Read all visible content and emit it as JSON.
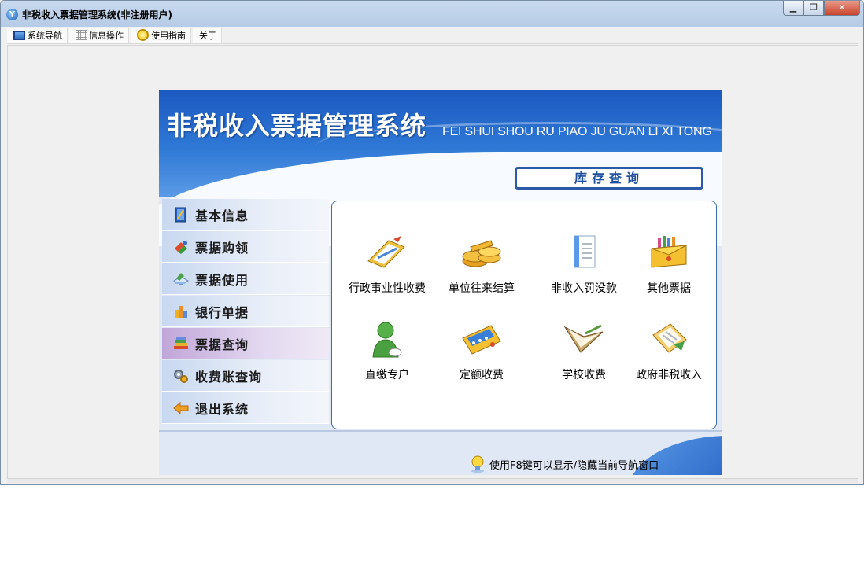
{
  "window": {
    "title": "非税收入票据管理系统(非注册用户)",
    "app_icon": "app-logo-icon",
    "controls": {
      "minimize": "▁",
      "restore": "❐",
      "close": "✕"
    }
  },
  "menubar": {
    "items": [
      {
        "label": "系统导航",
        "icon": "navigation-icon"
      },
      {
        "label": "信息操作",
        "icon": "grid-icon"
      },
      {
        "label": "使用指南",
        "icon": "help-icon"
      },
      {
        "label": "关于",
        "icon": ""
      }
    ]
  },
  "banner": {
    "title": "非税收入票据管理系统",
    "subtitle": "FEI SHUI SHOU RU PIAO JU GUAN LI XI TONG"
  },
  "section": {
    "title": "库存查询"
  },
  "sidebar": {
    "items": [
      {
        "label": "基本信息",
        "icon": "book-icon",
        "active": false
      },
      {
        "label": "票据购领",
        "icon": "pencil-icon",
        "active": false
      },
      {
        "label": "票据使用",
        "icon": "papers-icon",
        "active": false
      },
      {
        "label": "银行单据",
        "icon": "bank-icon",
        "active": false
      },
      {
        "label": "票据查询",
        "icon": "books-icon",
        "active": true
      },
      {
        "label": "收费账查询",
        "icon": "gears-icon",
        "active": false
      },
      {
        "label": "退出系统",
        "icon": "exit-arrow-icon",
        "active": false
      }
    ]
  },
  "grid": {
    "items": [
      {
        "label": "行政事业性收费",
        "icon": "notepad-icon"
      },
      {
        "label": "单位往来结算",
        "icon": "coins-icon"
      },
      {
        "label": "非收入罚没款",
        "icon": "document-icon"
      },
      {
        "label": "其他票据",
        "icon": "folder-box-icon"
      },
      {
        "label": "直缴专户",
        "icon": "user-icon"
      },
      {
        "label": "定额收费",
        "icon": "calculator-icon"
      },
      {
        "label": "学校收费",
        "icon": "open-book-icon"
      },
      {
        "label": "政府非税收入",
        "icon": "ledger-icon"
      }
    ]
  },
  "hint": {
    "text": "使用F8键可以显示/隐藏当前导航窗口",
    "icon": "lightbulb-icon"
  },
  "colors": {
    "accent": "#1c59c0",
    "active_sidebar": "#c0a6d8",
    "section_border": "#2c5aa8"
  }
}
